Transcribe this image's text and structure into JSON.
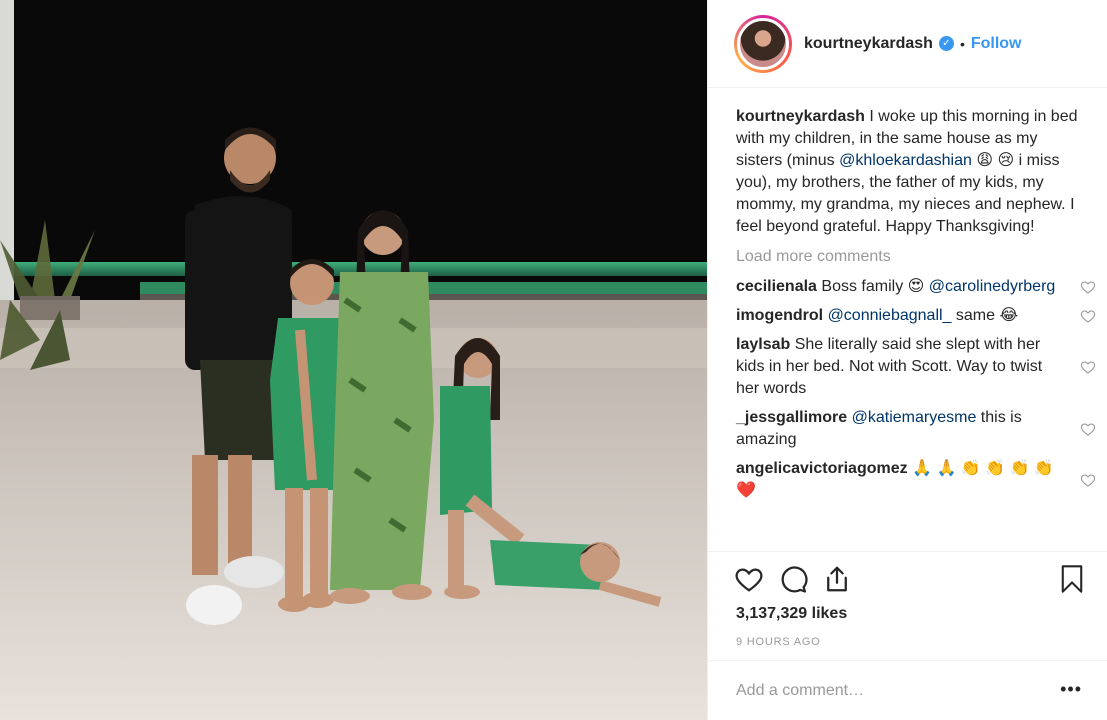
{
  "post": {
    "username": "kourtneykardash",
    "follow_label": "Follow",
    "separator": "•",
    "caption": {
      "username": "kourtneykardash",
      "text_1": " I woke up this morning in bed with my children, in the same house as my sisters (minus ",
      "mention": "@khloekardashian",
      "emoji": " 😩 😢 ",
      "text_2": "i miss you), my brothers, the father of my kids, my mommy, my grandma, my nieces and nephew. I feel beyond grateful. Happy Thanksgiving!"
    },
    "load_more": "Load more comments",
    "comments": [
      {
        "user": "cecilienala",
        "text_1": " Boss family 😍 ",
        "mention": "@carolinedyrberg",
        "text_2": ""
      },
      {
        "user": "imogendrol",
        "text_1": " ",
        "mention": "@conniebagnall_",
        "text_2": " same 😂"
      },
      {
        "user": "laylsab",
        "text_1": " She literally said she slept with her kids in her bed. Not with Scott. Way to twist her words",
        "mention": "",
        "text_2": ""
      },
      {
        "user": "_jessgallimore",
        "text_1": " ",
        "mention": "@katiemaryesme",
        "text_2": " this is amazing"
      },
      {
        "user": "angelicavictoriagomez",
        "text_1": " 🙏 🙏 👏 👏 👏 👏 ❤️",
        "mention": "",
        "text_2": ""
      }
    ],
    "likes": "3,137,329 likes",
    "time": "9 HOURS AGO",
    "add_comment_placeholder": "Add a comment…",
    "more_label": "•••"
  },
  "icons": {
    "verified": "verified-badge-icon",
    "like": "heart-icon",
    "comment": "comment-bubble-icon",
    "share": "share-icon",
    "save": "bookmark-icon",
    "options": "more-options-icon"
  },
  "colors": {
    "link": "#3897f0",
    "mention": "#003569",
    "muted": "#999999",
    "text": "#262626"
  }
}
